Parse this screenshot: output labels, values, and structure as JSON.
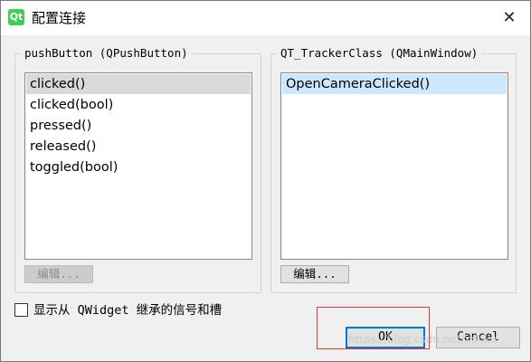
{
  "window": {
    "title": "配置连接",
    "app_icon_text": "Qt",
    "close_glyph": "✕"
  },
  "sender": {
    "group_title": "pushButton (QPushButton)",
    "signals": [
      "clicked()",
      "clicked(bool)",
      "pressed()",
      "released()",
      "toggled(bool)"
    ],
    "selected_index": 0,
    "edit_label": "编辑..."
  },
  "receiver": {
    "group_title": "QT_TrackerClass (QMainWindow)",
    "slots": [
      "OpenCameraClicked()"
    ],
    "selected_index": 0,
    "edit_label": "编辑..."
  },
  "options": {
    "show_inherited_label": "显示从 QWidget 继承的信号和槽",
    "show_inherited_checked": false
  },
  "buttons": {
    "ok": "OK",
    "cancel": "Cancel"
  },
  "watermark": "https://blog.csdn.net/xdoku",
  "colors": {
    "ok_focus_border": "#0078d7",
    "selection_blue": "#cce8ff",
    "selection_gray": "#d9d9d9",
    "annotation_red": "#e53935"
  },
  "icons": {
    "app": "qt-logo-icon",
    "close": "close-icon"
  }
}
